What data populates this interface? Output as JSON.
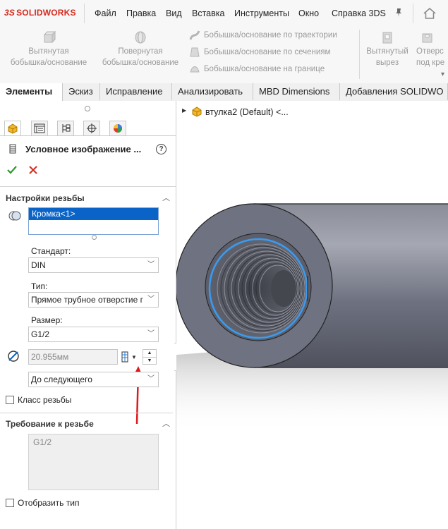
{
  "app": {
    "brand": "SOLIDWORKS",
    "brand_prefix": "3S"
  },
  "menu": [
    "Файл",
    "Правка",
    "Вид",
    "Вставка",
    "Инструменты",
    "Окно",
    "Справка 3DS"
  ],
  "ribbon": {
    "extruded_boss": "Вытянутая\nбобышка/основание",
    "revolved_boss": "Повернутая\nбобышка/основание",
    "swept_boss": "Бобышка/основание по траектории",
    "lofted_boss": "Бобышка/основание по сечениям",
    "boundary_boss": "Бобышка/основание на границе",
    "extruded_cut": "Вытянутый\nвырез",
    "revolved_cut": "Отверс\nпод кре"
  },
  "tabs": [
    "Элементы",
    "Эскиз",
    "Исправление",
    "Анализировать",
    "MBD Dimensions",
    "Добавления SOLIDWO"
  ],
  "panel": {
    "title": "Условное изображение ...",
    "help": "?",
    "thread_settings": {
      "header": "Настройки резьбы",
      "edge_selection": "Кромка<1>",
      "standard_label": "Стандарт:",
      "standard_value": "DIN",
      "type_label": "Тип:",
      "type_value": "Прямое трубное отверстие г",
      "size_label": "Размер:",
      "size_value": "G1/2",
      "diameter_value": "20.955мм",
      "end_condition": "До следующего",
      "thread_class_label": "Класс резьбы"
    },
    "thread_callout": {
      "header": "Требование к резьбе",
      "value": "G1/2",
      "show_type_label": "Отобразить тип"
    }
  },
  "tree": {
    "root": "втулка2 (Default) <..."
  },
  "colors": {
    "accent_red": "#d52b1e",
    "selection_blue": "#0a64c8",
    "ok_green": "#2c9a2c",
    "annotation_red": "#e0191b",
    "edge_highlight": "#3a9bf0"
  }
}
